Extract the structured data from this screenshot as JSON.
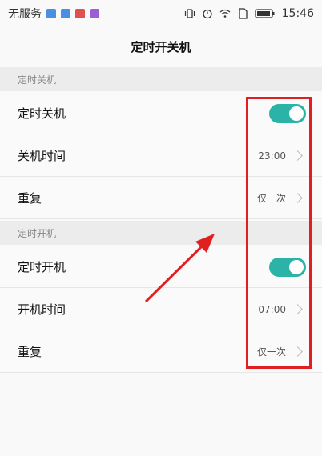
{
  "status_bar": {
    "carrier": "无服务",
    "time": "15:46",
    "notification_colors": [
      "#4a90e2",
      "#4a90e2",
      "#e05050",
      "#9a5fd6"
    ]
  },
  "title": "定时开关机",
  "sections": [
    {
      "header": "定时关机",
      "rows": [
        {
          "label": "定时关机",
          "toggle_on": true
        },
        {
          "label": "关机时间",
          "value": "23:00"
        },
        {
          "label": "重复",
          "value": "仅一次"
        }
      ]
    },
    {
      "header": "定时开机",
      "rows": [
        {
          "label": "定时开机",
          "toggle_on": true
        },
        {
          "label": "开机时间",
          "value": "07:00"
        },
        {
          "label": "重复",
          "value": "仅一次"
        }
      ]
    }
  ],
  "colors": {
    "toggle_accent": "#2bb3a7",
    "annotation_red": "#e02020"
  }
}
